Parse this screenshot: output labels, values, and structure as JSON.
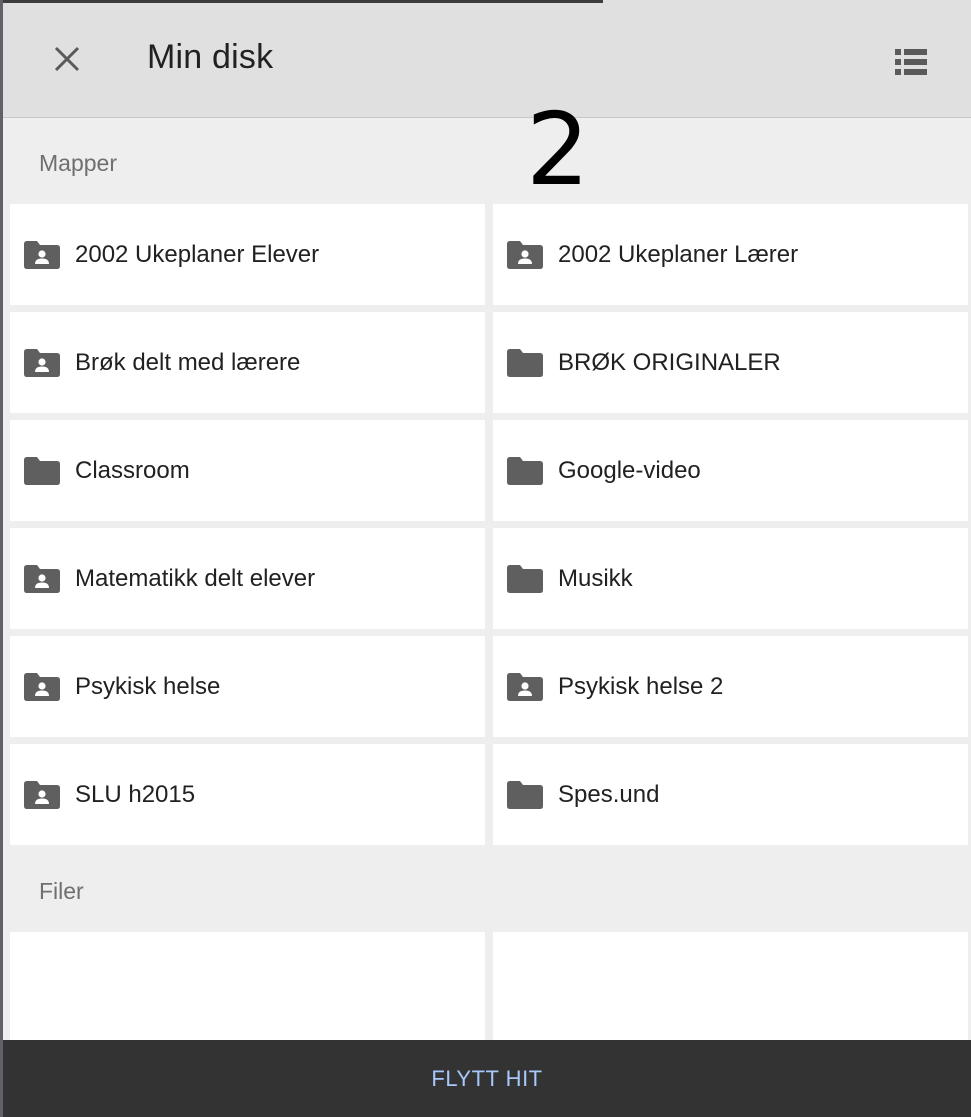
{
  "header": {
    "title": "Min disk",
    "close_icon": "close-icon",
    "view_icon": "list-view-icon"
  },
  "overlay_number": "2",
  "sections": {
    "folders_label": "Mapper",
    "files_label": "Filer"
  },
  "folders": [
    {
      "name": "2002 Ukeplaner Elever",
      "shared": true
    },
    {
      "name": "2002 Ukeplaner Lærer",
      "shared": true
    },
    {
      "name": "Brøk delt med lærere",
      "shared": true
    },
    {
      "name": "BRØK ORIGINALER",
      "shared": false
    },
    {
      "name": "Classroom",
      "shared": false
    },
    {
      "name": "Google-video",
      "shared": false
    },
    {
      "name": "Matematikk delt elever",
      "shared": true
    },
    {
      "name": "Musikk",
      "shared": false
    },
    {
      "name": "Psykisk helse",
      "shared": true
    },
    {
      "name": "Psykisk helse 2",
      "shared": true
    },
    {
      "name": "SLU h2015",
      "shared": true
    },
    {
      "name": "Spes.und",
      "shared": false
    }
  ],
  "bottom_bar": {
    "move_label": "FLYTT HIT"
  },
  "colors": {
    "header_bg": "#e0e0e0",
    "content_bg": "#eeeeee",
    "folder_icon": "#5f5f5f",
    "bottom_bar_bg": "#333333",
    "accent": "#a8c7fa"
  }
}
